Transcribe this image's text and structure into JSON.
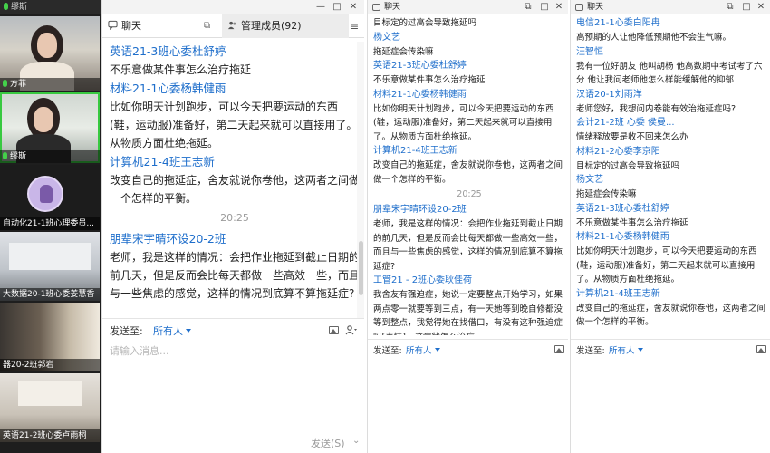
{
  "video": {
    "top_label": "缪斯",
    "tiles": [
      {
        "name": "方菲"
      },
      {
        "name": "缪斯"
      },
      {
        "name": "自动化21-1班心理委员..."
      },
      {
        "name": "大数据20-1班心委姜慧香"
      },
      {
        "name": "器20-2班郭岩"
      },
      {
        "name": "英语21-2班心委卢雨桐"
      }
    ]
  },
  "panel_a": {
    "tab_chat": "聊天",
    "tab_members": "管理成员(92)",
    "messages": [
      {
        "name": "英语21-3班心委杜舒婷",
        "text": "不乐意做某件事怎么治疗拖延"
      },
      {
        "name": "材料21-1心委杨韩健雨",
        "text": "比如你明天计划跑步，可以今天把要运动的东西(鞋，运动服)准备好，第二天起来就可以直接用了。从物质方面杜绝拖延。"
      },
      {
        "name": "计算机21-4班王志新",
        "text": "改变自己的拖延症，舍友就说你卷他，这两者之间做一个怎样的平衡。"
      },
      {
        "time": "20:25"
      },
      {
        "name": "朋辈宋宇晴环设20-2班",
        "text": "老师，我是这样的情况：会把作业拖延到截止日期的前几天，但是反而会比每天都做一些高效一些，而且与一些焦虑的感觉，这样的情况到底算不算拖延症?"
      }
    ],
    "send_to_label": "发送至:",
    "send_to_target": "所有人",
    "input_placeholder": "请输入消息...",
    "send_button": "发送(S)"
  },
  "panel_b": {
    "title": "聊天",
    "messages": [
      {
        "text": "目标定的过高会导致拖延吗"
      },
      {
        "name": "杨文艺",
        "text": "拖延症会传染嘛"
      },
      {
        "name": "英语21-3班心委杜舒婷",
        "text": "不乐意做某件事怎么治疗拖延"
      },
      {
        "name": "材料21-1心委杨韩健雨",
        "text": "比如你明天计划跑步，可以今天把要运动的东西(鞋，运动服)准备好，第二天起来就可以直接用了。从物质方面杜绝拖延。"
      },
      {
        "name": "计算机21-4班王志新",
        "text": "改变自己的拖延症，舍友就说你卷他，这两者之间做一个怎样的平衡。"
      },
      {
        "time": "20:25"
      },
      {
        "name": "朋辈宋宇晴环设20-2班",
        "text": "老师，我是这样的情况：会把作业拖延到截止日期的前几天，但是反而会比每天都做一些高效一些，而且与一些焦虑的感觉，这样的情况到底算不算拖延症?"
      },
      {
        "name": "工管21 - 2班心委耿佳荷",
        "text": "我舍友有强迫症，她说一定要整点开始学习，如果两点零一就要等到三点，有一天她等到晚自修都没等到整点，我觉得她在找借口，有没有这种强迫症吗[表情]，这症状怎么治疗"
      }
    ],
    "send_to_label": "发送至:",
    "send_to_target": "所有人"
  },
  "panel_c": {
    "title": "聊天",
    "messages": [
      {
        "name": "电信21-1心委白阳冉",
        "text": "高预期的人让他降低预期他不会生气嘛。"
      },
      {
        "name": "汪智恒",
        "text": "我有一位好朋友 他叫胡杨 他高数期中考试考了六分 他让我问老师他怎么样能缓解他的抑郁"
      },
      {
        "name": "汉语20-1刘雨洋",
        "text": "老师您好，我想问内卷能有效治拖延症吗?"
      },
      {
        "name": "会计21-2班 心委 侯曼...",
        "text": "情绪释放要是收不回来怎么办"
      },
      {
        "name": "材料21-2心委李京阳",
        "text": "目标定的过高会导致拖延吗"
      },
      {
        "name": "杨文艺",
        "text": "拖延症会传染嘛"
      },
      {
        "name": "英语21-3班心委杜舒婷",
        "text": "不乐意做某件事怎么治疗拖延"
      },
      {
        "name": "材料21-1心委杨韩健雨",
        "text": "比如你明天计划跑步，可以今天把要运动的东西(鞋，运动服)准备好，第二天起来就可以直接用了。从物质方面杜绝拖延。"
      },
      {
        "name": "计算机21-4班王志新",
        "text": "改变自己的拖延症，舍友就说你卷他，这两者之间做一个怎样的平衡。"
      }
    ],
    "send_to_label": "发送至:",
    "send_to_target": "所有人"
  }
}
